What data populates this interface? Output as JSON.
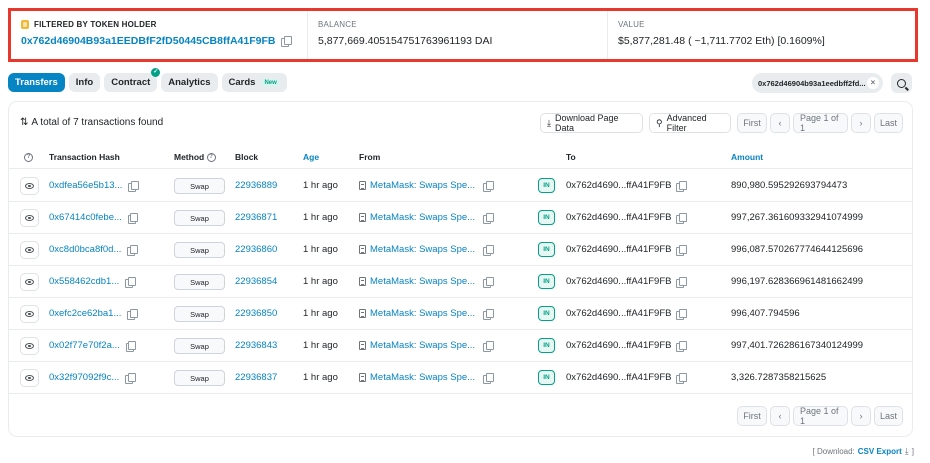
{
  "summary": {
    "filtered_label": "FILTERED BY TOKEN HOLDER",
    "holder_address": "0x762d46904B93a1EEDBfF2fD50445CB8ffA41F9FB",
    "balance_label": "BALANCE",
    "balance_value": "5,877,669.405154751763961193 DAI",
    "value_label": "VALUE",
    "value_value": "$5,877,281.48 ( ~1,711.7702 Eth) [0.1609%]"
  },
  "tabs": [
    {
      "label": "Transfers",
      "active": true
    },
    {
      "label": "Info"
    },
    {
      "label": "Contract",
      "verified_mark": "✓"
    },
    {
      "label": "Analytics"
    },
    {
      "label": "Cards",
      "badge": "New"
    }
  ],
  "filter_chip": {
    "text": "0x762d46904b93a1eedbff2fd...",
    "close": "×"
  },
  "toolbar": {
    "total_text": "A total of 7 transactions found",
    "download_page_data": "Download Page Data",
    "advanced_filter": "Advanced Filter"
  },
  "pagination": {
    "first": "First",
    "prev": "‹",
    "page": "Page 1 of 1",
    "next": "›",
    "last": "Last"
  },
  "columns": {
    "info": "?",
    "tx_hash": "Transaction Hash",
    "method": "Method",
    "block": "Block",
    "age": "Age",
    "from": "From",
    "to": "To",
    "amount": "Amount"
  },
  "rows": [
    {
      "hash": "0xdfea56e5b13...",
      "method": "Swap",
      "block": "22936889",
      "age": "1 hr ago",
      "from": "MetaMask: Swaps Spe...",
      "dir": "IN",
      "to": "0x762d4690...ffA41F9FB",
      "amount": "890,980.595292693794473"
    },
    {
      "hash": "0x67414c0febe...",
      "method": "Swap",
      "block": "22936871",
      "age": "1 hr ago",
      "from": "MetaMask: Swaps Spe...",
      "dir": "IN",
      "to": "0x762d4690...ffA41F9FB",
      "amount": "997,267.361609332941074999"
    },
    {
      "hash": "0xc8d0bca8f0d...",
      "method": "Swap",
      "block": "22936860",
      "age": "1 hr ago",
      "from": "MetaMask: Swaps Spe...",
      "dir": "IN",
      "to": "0x762d4690...ffA41F9FB",
      "amount": "996,087.570267774644125696"
    },
    {
      "hash": "0x558462cdb1...",
      "method": "Swap",
      "block": "22936854",
      "age": "1 hr ago",
      "from": "MetaMask: Swaps Spe...",
      "dir": "IN",
      "to": "0x762d4690...ffA41F9FB",
      "amount": "996,197.628366961481662499"
    },
    {
      "hash": "0xefc2ce62ba1...",
      "method": "Swap",
      "block": "22936850",
      "age": "1 hr ago",
      "from": "MetaMask: Swaps Spe...",
      "dir": "IN",
      "to": "0x762d4690...ffA41F9FB",
      "amount": "996,407.794596"
    },
    {
      "hash": "0x02f77e70f2a...",
      "method": "Swap",
      "block": "22936843",
      "age": "1 hr ago",
      "from": "MetaMask: Swaps Spe...",
      "dir": "IN",
      "to": "0x762d4690...ffA41F9FB",
      "amount": "997,401.726286167340124999"
    },
    {
      "hash": "0x32f97092f9c...",
      "method": "Swap",
      "block": "22936837",
      "age": "1 hr ago",
      "from": "MetaMask: Swaps Spe...",
      "dir": "IN",
      "to": "0x762d4690...ffA41F9FB",
      "amount": "3,326.7287358215625"
    }
  ],
  "download": {
    "prefix": "[ Download:",
    "link": "CSV Export",
    "suffix": "]"
  },
  "colors": {
    "accent": "#0784c3",
    "highlight_border": "#e8372c",
    "in_badge": "#00a186"
  }
}
